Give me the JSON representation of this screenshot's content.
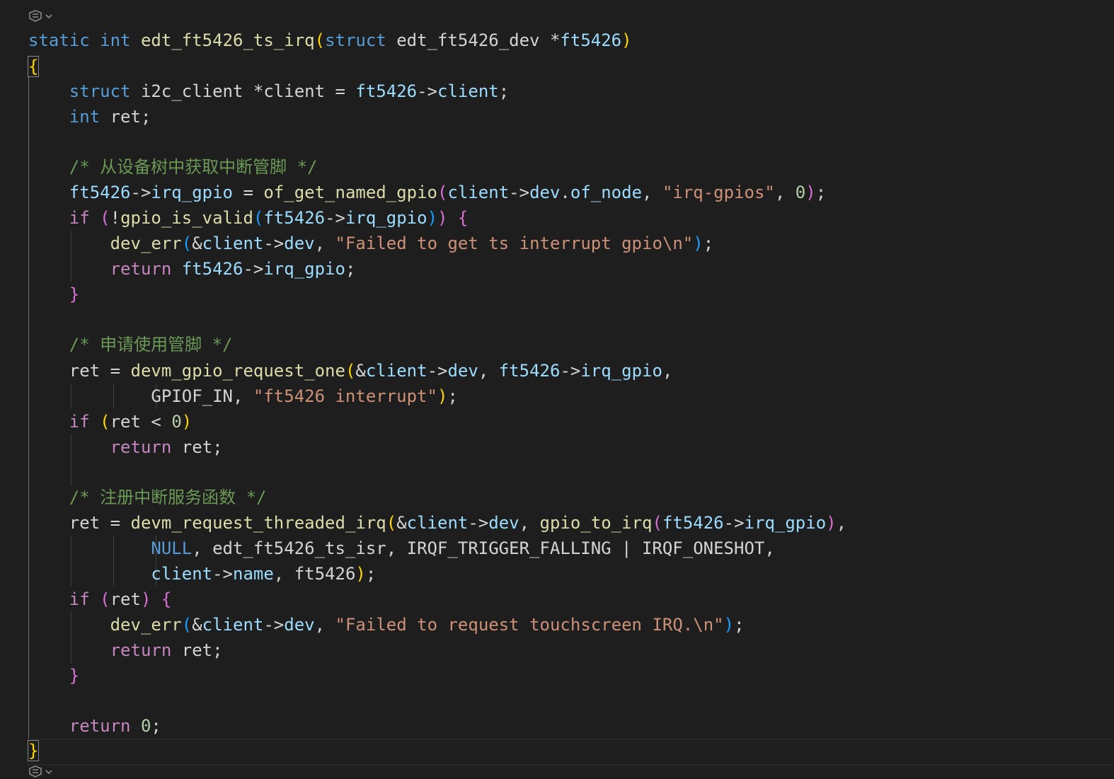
{
  "editor": {
    "lines": {
      "l1": {
        "kw1": "static",
        "kw2": "int",
        "fname": "edt_ft5426_ts_irq",
        "paren_open": "(",
        "kw3": "struct",
        "type": "edt_ft5426_dev",
        "star": "*",
        "param": "ft5426",
        "paren_close": ")"
      },
      "l2": {
        "brace": "{"
      },
      "l3": {
        "kw": "struct",
        "type": "i2c_client",
        "rest1": "*client",
        "eq": " = ",
        "obj": "ft5426",
        "arrow": "->",
        "field": "client",
        "semi": ";"
      },
      "l4": {
        "kw": "int",
        "rest": " ret;"
      },
      "l6": {
        "comment": "/* 从设备树中获取中断管脚 */"
      },
      "l7": {
        "obj": "ft5426",
        "arrow": "->",
        "field": "irq_gpio",
        "eq": " = ",
        "fn": "of_get_named_gpio",
        "po": "(",
        "a1": "client",
        "arrow2": "->",
        "a2": "dev",
        "dot": ".",
        "a3": "of_node",
        "comma": ", ",
        "str": "\"irq-gpios\"",
        "comma2": ", ",
        "num": "0",
        "pc": ")",
        "semi": ";"
      },
      "l8": {
        "kw": "if",
        "sp": " ",
        "po": "(",
        "bang": "!",
        "fn": "gpio_is_valid",
        "po2": "(",
        "obj": "ft5426",
        "arrow": "->",
        "field": "irq_gpio",
        "pc2": ")",
        "pc": ")",
        "sp2": " ",
        "brace": "{"
      },
      "l9": {
        "fn": "dev_err",
        "po": "(",
        "amp": "&",
        "a1": "client",
        "arrow": "->",
        "a2": "dev",
        "comma": ", ",
        "str": "\"Failed to get ts interrupt gpio\\n\"",
        "pc": ")",
        "semi": ";"
      },
      "l10": {
        "kw": "return",
        "sp": " ",
        "obj": "ft5426",
        "arrow": "->",
        "field": "irq_gpio",
        "semi": ";"
      },
      "l11": {
        "brace": "}"
      },
      "l13": {
        "comment": "/* 申请使用管脚 */"
      },
      "l14": {
        "v": "ret",
        "eq": " = ",
        "fn": "devm_gpio_request_one",
        "po": "(",
        "amp": "&",
        "a1": "client",
        "arrow": "->",
        "a2": "dev",
        "comma": ", ",
        "obj": "ft5426",
        "arrow2": "->",
        "field": "irq_gpio",
        "comma2": ","
      },
      "l15": {
        "c": "GPIOF_IN",
        "comma": ", ",
        "str": "\"ft5426 interrupt\"",
        "pc": ")",
        "semi": ";"
      },
      "l16": {
        "kw": "if",
        "sp": " ",
        "po": "(",
        "v": "ret",
        "op": " < ",
        "num": "0",
        "pc": ")"
      },
      "l17": {
        "kw": "return",
        "rest": " ret;"
      },
      "l19": {
        "comment": "/* 注册中断服务函数 */"
      },
      "l20": {
        "v": "ret",
        "eq": " = ",
        "fn": "devm_request_threaded_irq",
        "po": "(",
        "amp": "&",
        "a1": "client",
        "arrow": "->",
        "a2": "dev",
        "comma": ", ",
        "fn2": "gpio_to_irq",
        "po2": "(",
        "obj": "ft5426",
        "arrow2": "->",
        "field": "irq_gpio",
        "pc2": ")",
        "comma2": ","
      },
      "l21": {
        "null": "NULL",
        "rest": ", edt_ft5426_ts_isr, IRQF_TRIGGER_FALLING | IRQF_ONESHOT,"
      },
      "l22": {
        "a1": "client",
        "arrow": "->",
        "a2": "name",
        "rest": ", ft5426",
        "pc": ")",
        "semi": ";"
      },
      "l23": {
        "kw": "if",
        "sp": " ",
        "po": "(",
        "v": "ret",
        "pc": ")",
        "sp2": " ",
        "brace": "{"
      },
      "l24": {
        "fn": "dev_err",
        "po": "(",
        "amp": "&",
        "a1": "client",
        "arrow": "->",
        "a2": "dev",
        "comma": ", ",
        "str": "\"Failed to request touchscreen IRQ.\\n\"",
        "pc": ")",
        "semi": ";"
      },
      "l25": {
        "kw": "return",
        "rest": " ret;"
      },
      "l26": {
        "brace": "}"
      },
      "l28": {
        "kw": "return",
        "sp": " ",
        "num": "0",
        "semi": ";"
      },
      "l29": {
        "brace": "}"
      }
    }
  }
}
